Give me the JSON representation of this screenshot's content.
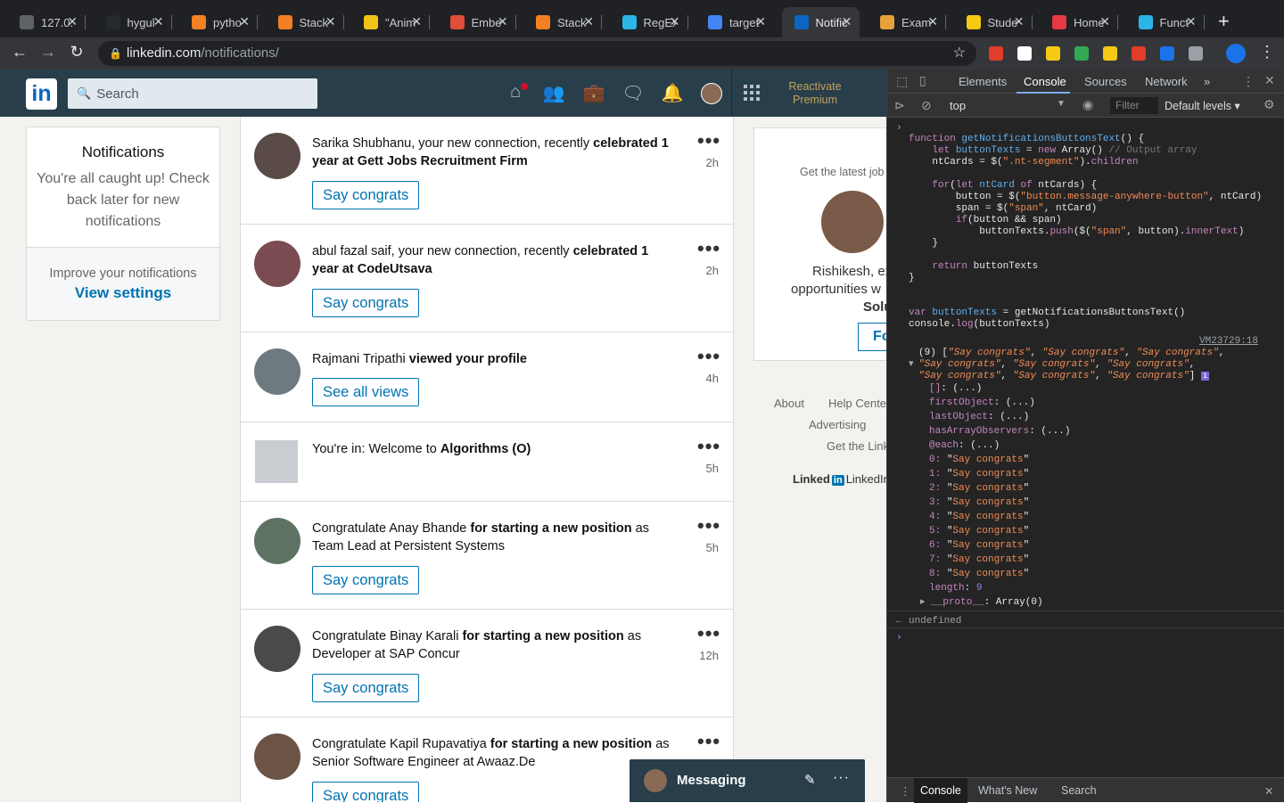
{
  "browser": {
    "tabs": [
      {
        "title": "127.0.",
        "color": "#5f6368"
      },
      {
        "title": "hygul",
        "color": "#24292e"
      },
      {
        "title": "pytho",
        "color": "#f48024"
      },
      {
        "title": "Stack",
        "color": "#f48024"
      },
      {
        "title": "\"Anim",
        "color": "#f0c419"
      },
      {
        "title": "Embe",
        "color": "#e04e39"
      },
      {
        "title": "Stack",
        "color": "#f48024"
      },
      {
        "title": "RegEx",
        "color": "#2bb5e7"
      },
      {
        "title": "target",
        "color": "#4285f4"
      },
      {
        "title": "Notific",
        "color": "#0a66c2"
      },
      {
        "title": "Exam",
        "color": "#e8a23a"
      },
      {
        "title": "Stude",
        "color": "#f6c915"
      },
      {
        "title": "Home",
        "color": "#e63946"
      },
      {
        "title": "Funct",
        "color": "#2bb5e7"
      }
    ],
    "active_tab": 9,
    "close_glyph": "✕",
    "new_tab_glyph": "+",
    "url_host": "linkedin.com",
    "url_path": "/notifications/",
    "extensions": [
      "#e23d28",
      "#ffffff",
      "#f6c915",
      "#34a853",
      "#f6c915",
      "#e23d28",
      "#1a73e8",
      "#9aa0a6"
    ]
  },
  "linkedin": {
    "logo": "in",
    "search_placeholder": "Search",
    "premium": "Reactivate Premium",
    "left": {
      "title": "Notifications",
      "caught_up": "You're all caught up! Check back later for new notifications",
      "improve": "Improve your notifications",
      "view_settings": "View settings"
    },
    "notifications": [
      {
        "pre": "Sarika Shubhanu, your new connection, recently ",
        "bold": "celebrated 1 year at Gett Jobs Recruitment Firm",
        "post": "",
        "time": "2h",
        "button": "Say congrats",
        "avatar": "#5a4a48"
      },
      {
        "pre": "abul fazal saif, your new connection, recently ",
        "bold": "celebrated 1 year at CodeUtsava",
        "post": "",
        "time": "2h",
        "button": "Say congrats",
        "avatar": "#7a4b50"
      },
      {
        "pre": "Rajmani Tripathi ",
        "bold": "viewed your profile",
        "post": "",
        "time": "4h",
        "button": "See all views",
        "avatar": "#6e7a80"
      },
      {
        "pre": "You're in: Welcome to ",
        "bold": "Algorithms (O)",
        "post": "",
        "time": "5h",
        "button": "",
        "avatar": "#c9cdd1"
      },
      {
        "pre": "Congratulate Anay Bhande ",
        "bold": "for starting a new position",
        "post": " as Team Lead at Persistent Systems",
        "time": "5h",
        "button": "Say congrats",
        "avatar": "#5e7264"
      },
      {
        "pre": "Congratulate Binay Karali ",
        "bold": "for starting a new position",
        "post": " as Developer at SAP Concur",
        "time": "12h",
        "button": "Say congrats",
        "avatar": "#4a4a4a"
      },
      {
        "pre": "Congratulate Kapil Rupavatiya ",
        "bold": "for starting a new position",
        "post": " as Senior Software Engineer at Awaaz.De",
        "time": "",
        "button": "Say congrats",
        "avatar": "#6b5446"
      }
    ],
    "right": {
      "latest": "Get the latest job",
      "name": "Rishikesh, ex",
      "opps": "opportunities w",
      "sol": "Solu",
      "follow": "Fo"
    },
    "footer": {
      "about": "About",
      "help": "Help Center",
      "advertising": "Advertising",
      "getapp": "Get the Link",
      "brand_a": "Linked",
      "brand_in": "in",
      "brand_b": "LinkedIn"
    },
    "messaging": "Messaging"
  },
  "devtools": {
    "tabs": [
      "Elements",
      "Console",
      "Sources",
      "Network"
    ],
    "more": "»",
    "context": "top",
    "filter_placeholder": "Filter",
    "levels": "Default levels ▾",
    "source_ref": "VM23729:18",
    "undefined": "undefined",
    "array_items": [
      "Say congrats",
      "Say congrats",
      "Say congrats",
      "Say congrats",
      "Say congrats",
      "Say congrats",
      "Say congrats",
      "Say congrats",
      "Say congrats"
    ],
    "length": 9,
    "bottom_tabs": [
      "Console",
      "What's New",
      "Search"
    ]
  }
}
